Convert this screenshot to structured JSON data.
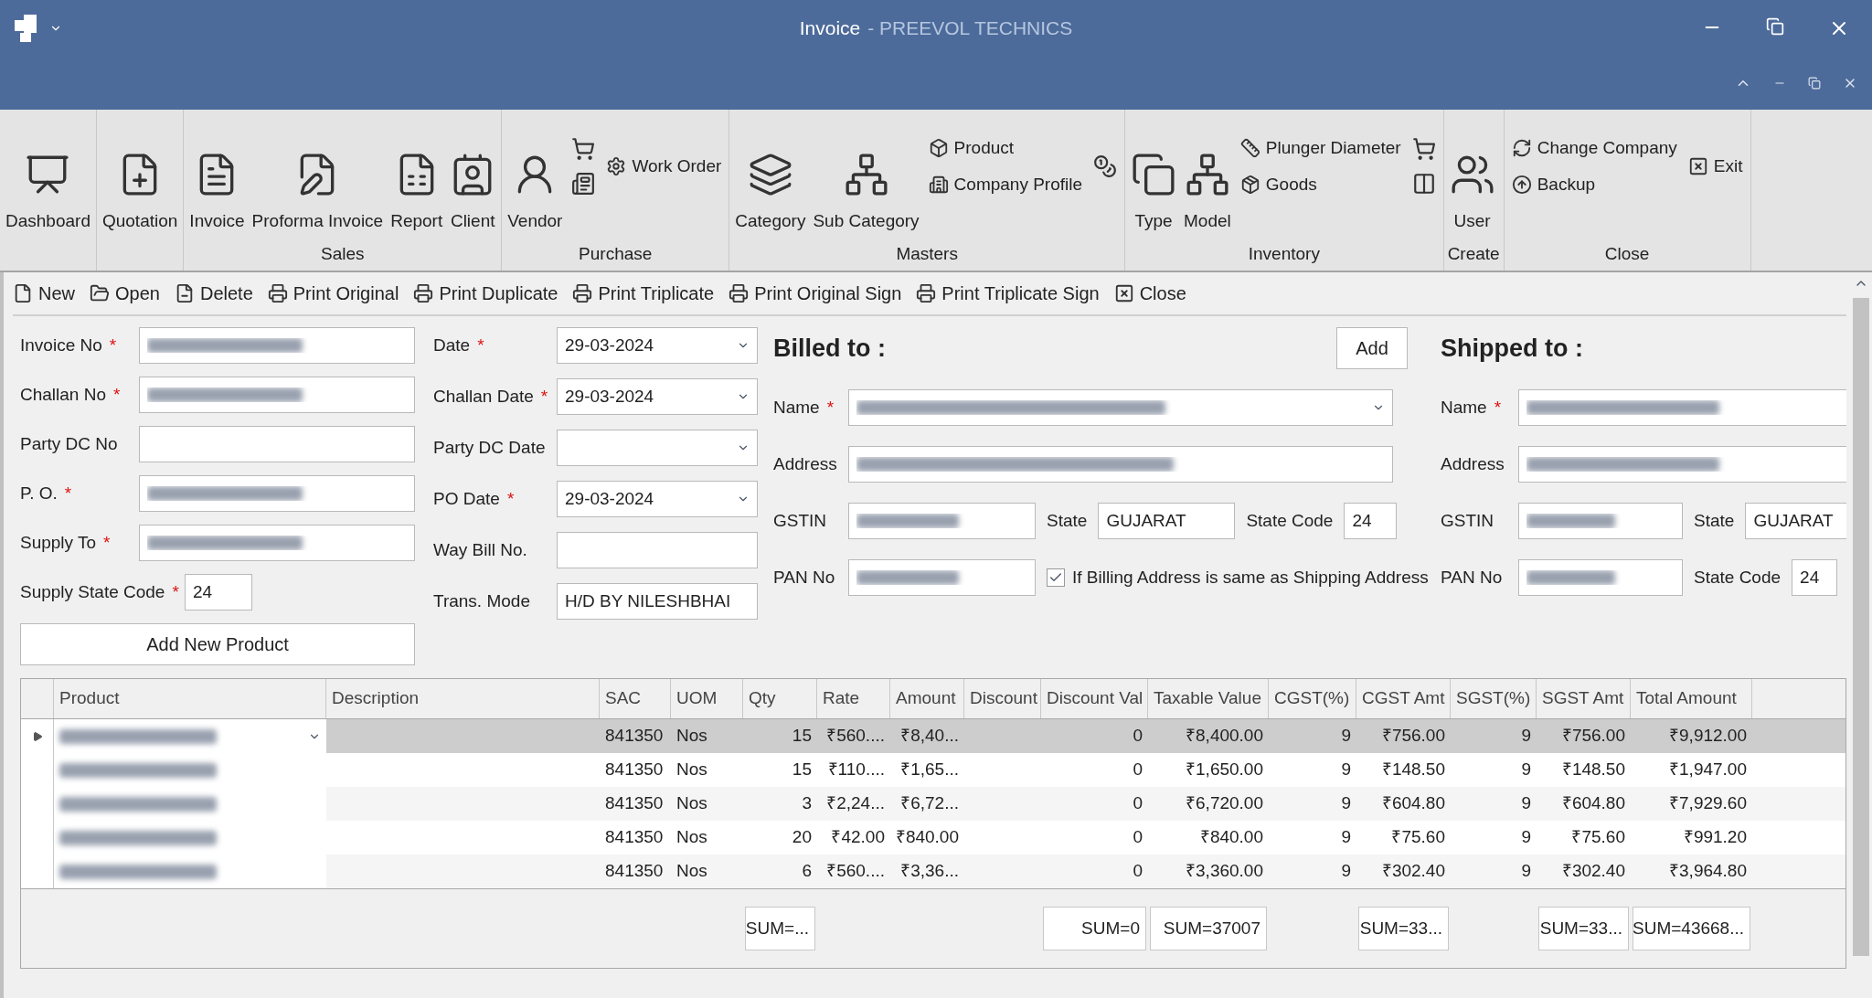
{
  "window": {
    "title": "Invoice",
    "subtitle": "- PREEVOL TECHNICS"
  },
  "ribbon": {
    "groups": [
      {
        "items": [
          {
            "kind": "large",
            "label": "Dashboard"
          }
        ]
      },
      {
        "items": [
          {
            "kind": "large",
            "label": "Quotation"
          }
        ]
      },
      {
        "label": "Sales",
        "items": [
          {
            "kind": "large",
            "label": "Invoice"
          },
          {
            "kind": "large",
            "label": "Proforma Invoice"
          },
          {
            "kind": "large",
            "label": "Report"
          },
          {
            "kind": "large",
            "label": "Client"
          }
        ]
      },
      {
        "label": "Purchase",
        "items": [
          {
            "kind": "large",
            "label": "Vendor"
          },
          {
            "kind": "column",
            "items": [
              {
                "kind": "icon"
              },
              {
                "kind": "icon"
              }
            ]
          },
          {
            "kind": "column",
            "items": [
              {
                "kind": "small",
                "label": "Work Order"
              }
            ]
          }
        ]
      },
      {
        "label": "Masters",
        "items": [
          {
            "kind": "large",
            "label": "Category"
          },
          {
            "kind": "large",
            "label": "Sub Category"
          },
          {
            "kind": "column",
            "items": [
              {
                "kind": "small",
                "label": "Product"
              },
              {
                "kind": "small",
                "label": "Company Profile"
              }
            ]
          },
          {
            "kind": "column",
            "items": [
              {
                "kind": "icon"
              }
            ]
          }
        ]
      },
      {
        "label": "Inventory",
        "items": [
          {
            "kind": "large",
            "label": "Type"
          },
          {
            "kind": "large",
            "label": "Model"
          },
          {
            "kind": "column",
            "items": [
              {
                "kind": "small",
                "label": "Plunger Diameter"
              },
              {
                "kind": "small",
                "label": "Goods"
              }
            ]
          },
          {
            "kind": "column",
            "items": [
              {
                "kind": "icon"
              },
              {
                "kind": "icon"
              }
            ]
          }
        ]
      },
      {
        "label": "Create",
        "items": [
          {
            "kind": "large",
            "label": "User"
          }
        ]
      },
      {
        "label": "Close",
        "items": [
          {
            "kind": "column",
            "items": [
              {
                "kind": "small",
                "label": "Change Company"
              },
              {
                "kind": "small",
                "label": "Backup"
              }
            ]
          },
          {
            "kind": "column",
            "items": [
              {
                "kind": "small",
                "label": "Exit"
              }
            ]
          }
        ]
      }
    ]
  },
  "toolbar": [
    {
      "label": "New"
    },
    {
      "label": "Open"
    },
    {
      "label": "Delete"
    },
    {
      "label": "Print Original"
    },
    {
      "label": "Print Duplicate"
    },
    {
      "label": "Print Triplicate"
    },
    {
      "label": "Print Original Sign"
    },
    {
      "label": "Print Triplicate Sign"
    },
    {
      "label": "Close"
    }
  ],
  "form": {
    "left": [
      {
        "label": "Invoice No",
        "mark": "*",
        "kind": "text",
        "blurred": true
      },
      {
        "label": "Challan No",
        "mark": "*",
        "kind": "text",
        "blurred": true
      },
      {
        "label": "Party DC No",
        "kind": "text",
        "blurred": false
      },
      {
        "label": "P. O.",
        "mark": "*",
        "kind": "text",
        "blurred": true
      },
      {
        "label": "Supply To",
        "mark": "*",
        "kind": "text",
        "blurred": true
      },
      {
        "label": "Supply State Code",
        "mark": "*",
        "kind": "short",
        "value": "24",
        "blurred": false
      }
    ],
    "add_product_button": "Add New Product",
    "middle": [
      {
        "label": "Date",
        "mark": "*",
        "kind": "date",
        "value": "29-03-2024"
      },
      {
        "label": "Challan Date",
        "mark": "*",
        "kind": "date",
        "value": "29-03-2024"
      },
      {
        "label": "Party DC Date",
        "kind": "date"
      },
      {
        "label": "PO Date",
        "mark": "*",
        "kind": "date",
        "value": "29-03-2024"
      },
      {
        "label": "Way Bill No.",
        "kind": "text"
      },
      {
        "label": "Trans. Mode",
        "kind": "text",
        "value": "H/D BY NILESHBHAI"
      }
    ]
  },
  "billed_to": {
    "heading": "Billed to :",
    "add_button": "Add",
    "name_label": "Name",
    "name_mark": "*",
    "address_label": "Address",
    "gstin_label": "GSTIN",
    "state_label": "State",
    "state": "GUJARAT",
    "state_code_label": "State Code",
    "state_code": "24",
    "pan_label": "PAN No",
    "same_address": {
      "label": "If Billing Address is same as Shipping Address",
      "checked": true
    }
  },
  "shipped_to": {
    "heading": "Shipped to :",
    "name_label": "Name",
    "name_mark": "*",
    "address_label": "Address",
    "gstin_label": "GSTIN",
    "state_label": "State",
    "state": "GUJARAT",
    "pan_label": "PAN No",
    "state_code_label": "State Code",
    "state_code": "24"
  },
  "table": {
    "columns": [
      {
        "label": "Product"
      },
      {
        "label": "Description"
      },
      {
        "label": "SAC"
      },
      {
        "label": "UOM"
      },
      {
        "label": "Qty",
        "sum": "SUM=..."
      },
      {
        "label": "Rate"
      },
      {
        "label": "Amount"
      },
      {
        "label": "Discount"
      },
      {
        "label": "Discount Val",
        "sum": "SUM=0"
      },
      {
        "label": "Taxable Value",
        "sum": "SUM=37007"
      },
      {
        "label": "CGST(%)"
      },
      {
        "label": "CGST Amt",
        "sum": "SUM=33..."
      },
      {
        "label": "SGST(%)"
      },
      {
        "label": "SGST Amt",
        "sum": "SUM=33..."
      },
      {
        "label": "Total Amount",
        "sum": "SUM=43668..."
      }
    ],
    "rows": [
      {
        "selected": true,
        "cells": [
          "",
          "",
          "841350",
          "Nos",
          "15",
          "₹560....",
          "₹8,40...",
          "",
          "0",
          "₹8,400.00",
          "9",
          "₹756.00",
          "9",
          "₹756.00",
          "₹9,912.00"
        ]
      },
      {
        "selected": false,
        "cells": [
          "",
          "",
          "841350",
          "Nos",
          "15",
          "₹110....",
          "₹1,65...",
          "",
          "0",
          "₹1,650.00",
          "9",
          "₹148.50",
          "9",
          "₹148.50",
          "₹1,947.00"
        ]
      },
      {
        "selected": false,
        "cells": [
          "",
          "",
          "841350",
          "Nos",
          "3",
          "₹2,24...",
          "₹6,72...",
          "",
          "0",
          "₹6,720.00",
          "9",
          "₹604.80",
          "9",
          "₹604.80",
          "₹7,929.60"
        ]
      },
      {
        "selected": false,
        "cells": [
          "",
          "",
          "841350",
          "Nos",
          "20",
          "₹42.00",
          "₹840.00",
          "",
          "0",
          "₹840.00",
          "9",
          "₹75.60",
          "9",
          "₹75.60",
          "₹991.20"
        ]
      },
      {
        "selected": false,
        "cells": [
          "",
          "",
          "841350",
          "Nos",
          "6",
          "₹560....",
          "₹3,36...",
          "",
          "0",
          "₹3,360.00",
          "9",
          "₹302.40",
          "9",
          "₹302.40",
          "₹3,964.80"
        ]
      }
    ]
  }
}
